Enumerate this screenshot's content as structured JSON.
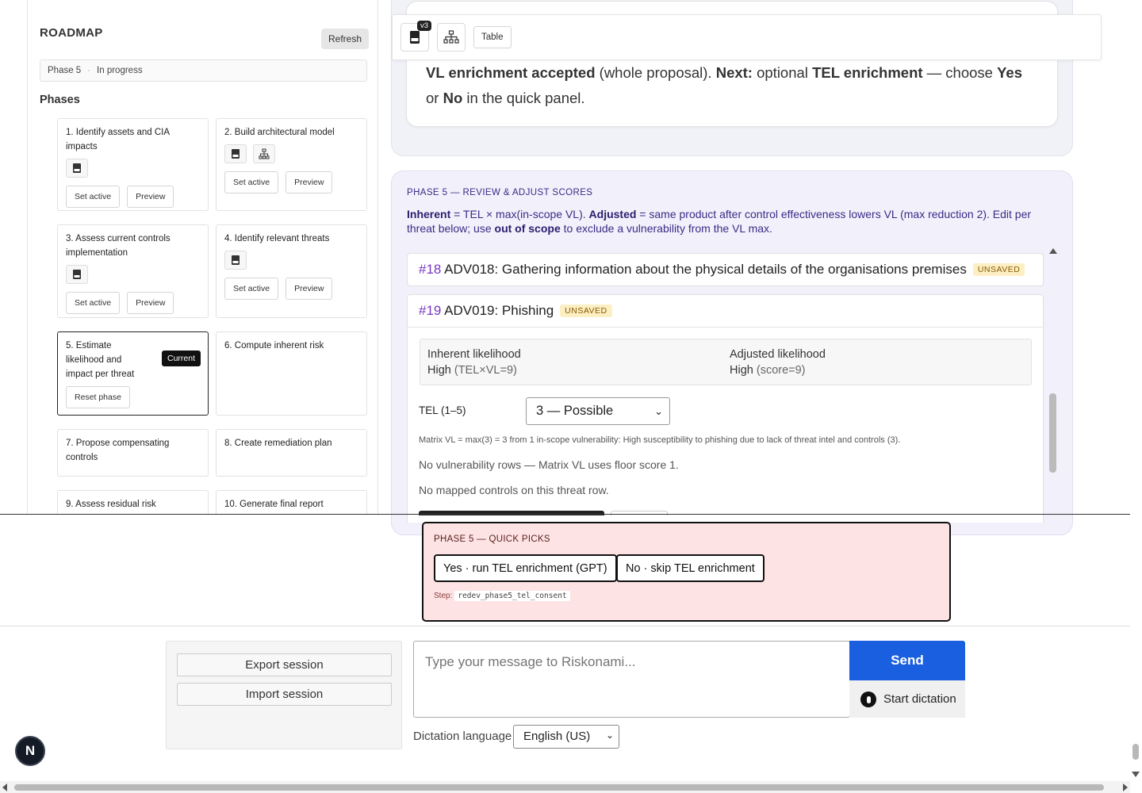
{
  "roadmap": {
    "title": "ROADMAP",
    "refresh_label": "Refresh",
    "phase_indicator": "Phase 5",
    "phase_state": "In progress",
    "phases_heading": "Phases",
    "cards": [
      {
        "title": "1. Identify assets and CIA impacts",
        "icons": [
          "json-file-icon"
        ],
        "actions": [
          "Set active",
          "Preview"
        ]
      },
      {
        "title": "2. Build architectural model",
        "icons": [
          "json-file-icon",
          "hierarchy-icon"
        ],
        "actions": [
          "Set active",
          "Preview"
        ]
      },
      {
        "title": "3. Assess current controls implementation",
        "icons": [
          "json-file-icon"
        ],
        "actions": [
          "Set active",
          "Preview"
        ]
      },
      {
        "title": "4. Identify relevant threats",
        "icons": [
          "json-file-icon"
        ],
        "actions": [
          "Set active",
          "Preview"
        ]
      },
      {
        "title": "5. Estimate likelihood and impact per threat",
        "badge": "Current",
        "actions": [
          "Reset phase"
        ]
      },
      {
        "title": "6. Compute inherent risk"
      },
      {
        "title": "7. Propose compensating controls"
      },
      {
        "title": "8. Create remediation plan"
      },
      {
        "title": "9. Assess residual risk"
      },
      {
        "title": "10. Generate final report"
      }
    ]
  },
  "toolbar": {
    "version_badge": "v3",
    "table_label": "Table"
  },
  "message_top": {
    "accepted_bold": "VL enrichment accepted",
    "accepted_rest": " (whole proposal). ",
    "next_bold": "Next:",
    "next_rest": " optional ",
    "tel_bold": "TEL enrichment",
    "choose_rest": " — choose ",
    "yes_bold": "Yes",
    "or_rest": " or ",
    "no_bold": "No",
    "tail": " in the quick panel."
  },
  "phase5": {
    "label": "PHASE 5 — REVIEW & ADJUST SCORES",
    "desc_inherent": "Inherent",
    "desc_1": " = TEL × max(in-scope VL). ",
    "desc_adjusted": "Adjusted",
    "desc_2": " = same product after control effectiveness lowers VL (max reduction 2). Edit per threat below; use ",
    "desc_oos": "out of scope",
    "desc_3": " to exclude a vulnerability from the VL max.",
    "threats": [
      {
        "num": "#18",
        "title": "ADV018: Gathering information about the physical details of the organisations premises",
        "status": "UNSAVED"
      },
      {
        "num": "#19",
        "title": "ADV019: Phishing",
        "status": "UNSAVED"
      }
    ],
    "inherent_label": "Inherent likelihood",
    "inherent_value": "High",
    "inherent_sub": "(TEL×VL=9)",
    "adjusted_label": "Adjusted likelihood",
    "adjusted_value": "High",
    "adjusted_sub": "(score=9)",
    "tel_label": "TEL (1–5)",
    "tel_value": "3 — Possible",
    "matrix_note": "Matrix VL = max(3) = 3 from 1 in-scope vulnerability: High susceptibility to phishing due to lack of threat intel and controls (3).",
    "no_vuln": "No vulnerability rows — Matrix VL uses floor score 1.",
    "no_controls": "No mapped controls on this threat row."
  },
  "quick_picks": {
    "label": "PHASE 5 — QUICK PICKS",
    "yes_label": "Yes · run TEL enrichment (GPT)",
    "no_label": "No · skip TEL enrichment",
    "step_label": "Step:",
    "step_code": "redev_phase5_tel_consent"
  },
  "session": {
    "export_label": "Export session",
    "import_label": "Import session"
  },
  "composer": {
    "placeholder": "Type your message to Riskonami...",
    "send_label": "Send",
    "dictation_label": "Start dictation",
    "dictation_language_label": "Dictation language",
    "dictation_language_value": "English (US)"
  },
  "avatar_letter": "N",
  "colors": {
    "accent_blue": "#1a5fe0",
    "phase5_text": "#3b2a86",
    "quick_bg": "#fde3e3",
    "unsaved_bg": "#fcefc4",
    "threat_num": "#7a36c6"
  }
}
